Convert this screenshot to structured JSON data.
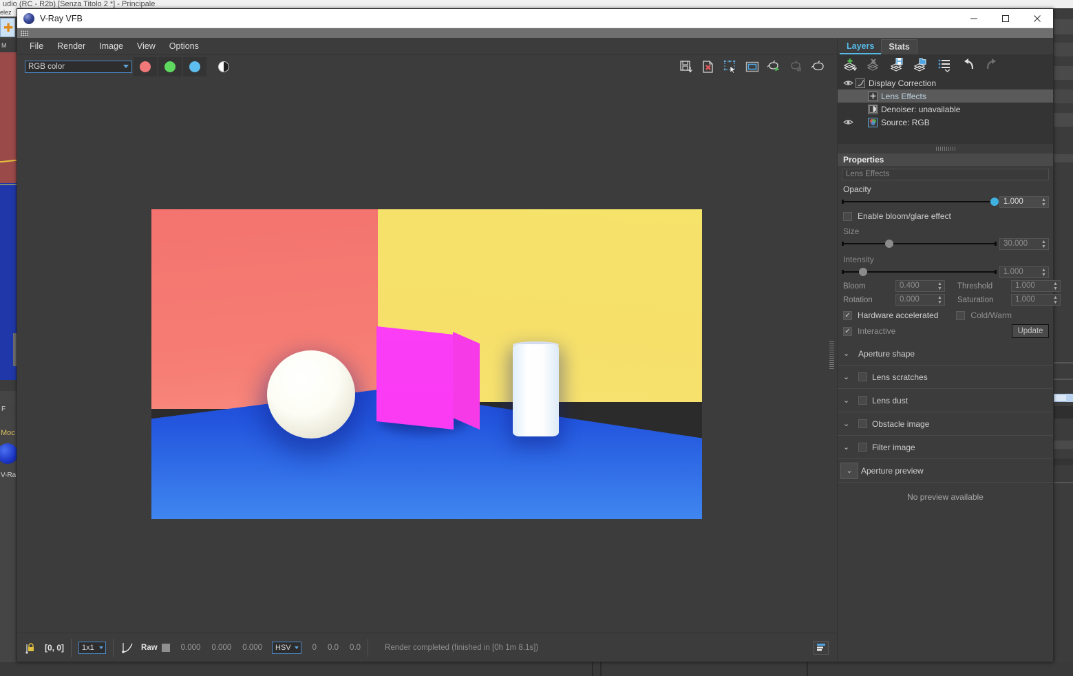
{
  "host_app": {
    "top_title": "udio (RC - R2b)  [Senza Titolo 2 *] - Principale",
    "left_tab": "elez",
    "menu_hint": "M",
    "mocap_label": "Moc",
    "vray_label": "V-Ra",
    "f_label": "F"
  },
  "window": {
    "title": "V-Ray VFB",
    "icon": "vray-sphere-icon",
    "minimize": "—",
    "maximize": "☐",
    "close": "✕"
  },
  "menubar": {
    "items": [
      "File",
      "Render",
      "Image",
      "View",
      "Options"
    ]
  },
  "toolbar": {
    "channel_value": "RGB color",
    "channel_options": [
      "RGB color"
    ],
    "buttons": [
      {
        "name": "red-channel-button",
        "icon": "red-circle-icon"
      },
      {
        "name": "green-channel-button",
        "icon": "green-circle-icon"
      },
      {
        "name": "blue-channel-button",
        "icon": "blue-circle-icon"
      },
      {
        "name": "alpha-channel-button",
        "icon": "half-circle-icon"
      }
    ],
    "right_buttons": [
      {
        "name": "save-image-button",
        "icon": "save-floppy-icon"
      },
      {
        "name": "clear-image-button",
        "icon": "clear-image-icon"
      },
      {
        "name": "region-render-button",
        "icon": "region-select-icon"
      },
      {
        "name": "track-render-button",
        "icon": "frame-window-icon"
      },
      {
        "name": "start-render-button",
        "icon": "teapot-play-icon"
      },
      {
        "name": "stop-render-button",
        "icon": "teapot-stop-icon"
      },
      {
        "name": "render-last-button",
        "icon": "teapot-icon"
      }
    ]
  },
  "statusbar": {
    "lock_icon": "pixel-lock-icon",
    "coords": "[0, 0]",
    "zoom_value": "1x1",
    "zoom_options": [
      "1x1"
    ],
    "curve_icon": "curve-icon",
    "raw_label": "Raw",
    "raw_swatch_color": "#8f8f8f",
    "raw_values": [
      "0.000",
      "0.000",
      "0.000"
    ],
    "color_mode": "HSV",
    "color_mode_options": [
      "HSV"
    ],
    "hsv_values": [
      "0",
      "0.0",
      "0.0"
    ],
    "status_text": "Render completed (finished in [0h  1m  8.1s])",
    "right_button": "history-panel-icon"
  },
  "render": {
    "name": "render-preview",
    "scene": {
      "left_wall_color": "#f67a72",
      "right_wall_color": "#f6e06a",
      "floor_color_top": "#1b3bc8",
      "floor_color_bottom": "#3f86ef",
      "sphere_color": "#fefdf6",
      "cube_color": "#fb3df6",
      "cylinder_color": "#ffffff"
    }
  },
  "panel": {
    "tabs": [
      {
        "label": "Layers",
        "active": true
      },
      {
        "label": "Stats",
        "active": false
      }
    ],
    "layers_toolbar": [
      {
        "name": "add-layer-button",
        "icon": "layer-add-icon"
      },
      {
        "name": "delete-layer-button",
        "icon": "layer-delete-icon"
      },
      {
        "name": "save-layers-button",
        "icon": "layer-save-icon"
      },
      {
        "name": "load-layers-button",
        "icon": "layer-open-icon"
      },
      {
        "name": "layer-presets-button",
        "icon": "layer-list-icon"
      },
      {
        "name": "undo-button",
        "icon": "undo-arrow-icon"
      },
      {
        "name": "redo-button",
        "icon": "redo-arrow-icon"
      }
    ],
    "layers": [
      {
        "label": "Display Correction",
        "icon": "curve-layer-icon",
        "eye": true,
        "indent": 0,
        "selected": false
      },
      {
        "label": "Lens Effects",
        "icon": "plus-layer-icon",
        "eye": false,
        "indent": 1,
        "selected": true
      },
      {
        "label": "Denoiser: unavailable",
        "icon": "denoiser-icon",
        "eye": false,
        "indent": 1,
        "selected": false
      },
      {
        "label": "Source: RGB",
        "icon": "rgb-source-icon",
        "eye": true,
        "indent": 1,
        "selected": false
      }
    ],
    "properties": {
      "header": "Properties",
      "name_field": "Lens Effects",
      "opacity": {
        "label": "Opacity",
        "value": "1.000",
        "knob_percent": 98,
        "knob_color": "#3fb2e2",
        "enabled": true
      },
      "enable_bloom": {
        "label": "Enable bloom/glare effect",
        "checked": false
      },
      "size": {
        "label": "Size",
        "value": "30.000",
        "knob_percent": 30,
        "enabled": false
      },
      "intensity": {
        "label": "Intensity",
        "value": "1.000",
        "knob_percent": 12,
        "enabled": false
      },
      "fields": [
        {
          "label": "Bloom",
          "value": "0.400"
        },
        {
          "label": "Threshold",
          "value": "1.000"
        },
        {
          "label": "Rotation",
          "value": "0.000"
        },
        {
          "label": "Saturation",
          "value": "1.000"
        }
      ],
      "hardware_accelerated": {
        "label": "Hardware accelerated",
        "checked": true
      },
      "cold_warm": {
        "label": "Cold/Warm",
        "checked": false
      },
      "interactive": {
        "label": "Interactive",
        "checked": true
      },
      "update_button": "Update",
      "sections": [
        {
          "label": "Aperture shape",
          "has_checkbox": false,
          "checked": false,
          "boxed": false
        },
        {
          "label": "Lens scratches",
          "has_checkbox": true,
          "checked": false,
          "boxed": false
        },
        {
          "label": "Lens dust",
          "has_checkbox": true,
          "checked": false,
          "boxed": false
        },
        {
          "label": "Obstacle image",
          "has_checkbox": true,
          "checked": false,
          "boxed": false
        },
        {
          "label": "Filter image",
          "has_checkbox": true,
          "checked": false,
          "boxed": false
        },
        {
          "label": "Aperture preview",
          "has_checkbox": false,
          "checked": false,
          "boxed": true
        }
      ],
      "no_preview_text": "No preview available"
    }
  }
}
